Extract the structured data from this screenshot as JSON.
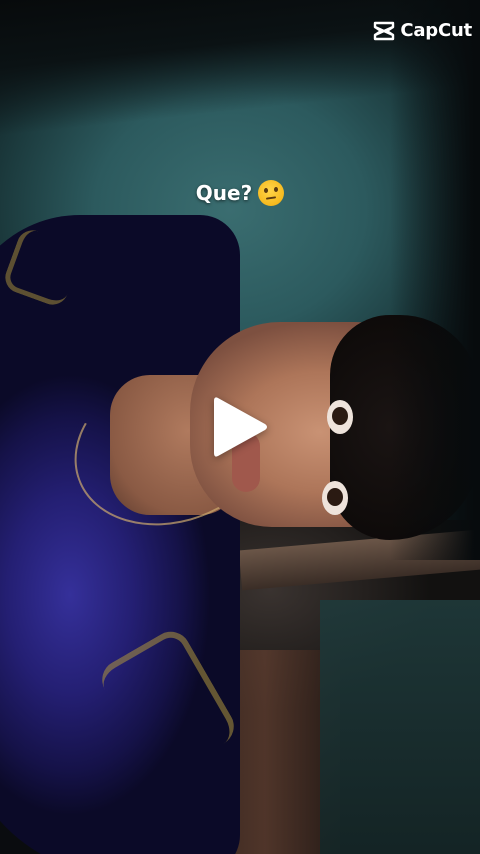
{
  "watermark": {
    "logo_icon": "capcut-logo-icon",
    "label": "CapCut"
  },
  "caption": {
    "text": "Que?",
    "emoji_icon": "raised-eyebrow-face-icon"
  },
  "player": {
    "play_icon": "play-icon",
    "state": "paused"
  },
  "colors": {
    "overlay_text": "#ffffff",
    "play_icon": "#ffffff"
  }
}
